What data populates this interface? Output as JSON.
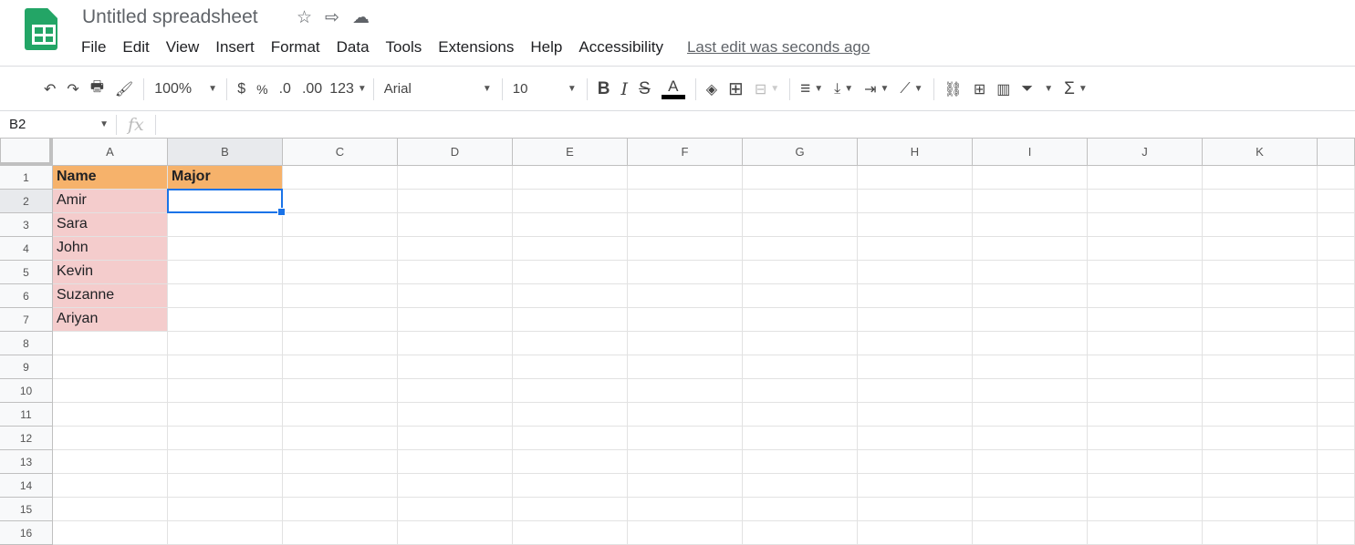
{
  "doc": {
    "title": "Untitled spreadsheet",
    "icons": [
      "star-icon",
      "move-to-folder-icon",
      "cloud-saved-icon"
    ]
  },
  "menu": [
    "File",
    "Edit",
    "View",
    "Insert",
    "Format",
    "Data",
    "Tools",
    "Extensions",
    "Help",
    "Accessibility"
  ],
  "last_edit": "Last edit was seconds ago",
  "toolbar": {
    "zoom": "100%",
    "currency": "$",
    "percent": "%",
    "dec_less": ".0",
    "dec_more": ".00",
    "more_formats": "123",
    "font": "Arial",
    "font_size": "10",
    "bold": "B",
    "italic": "I",
    "strike": "S",
    "text_color": "A",
    "text_color_value": "#000000"
  },
  "formula_bar": {
    "name_box": "B2",
    "fx": "fx",
    "value": ""
  },
  "grid": {
    "columns": [
      "A",
      "B",
      "C",
      "D",
      "E",
      "F",
      "G",
      "H",
      "I",
      "J",
      "K"
    ],
    "rows": [
      "1",
      "2",
      "3",
      "4",
      "5",
      "6",
      "7",
      "8",
      "9",
      "10",
      "11",
      "12",
      "13",
      "14",
      "15",
      "16"
    ],
    "selected_cell": "B2",
    "header_fill": "#f6b26b",
    "name_fill": "#f4cccc",
    "selection_color": "#1a73e8",
    "cells": [
      [
        "Name",
        "Major"
      ],
      [
        "Amir",
        ""
      ],
      [
        "Sara",
        ""
      ],
      [
        "John",
        ""
      ],
      [
        "Kevin",
        ""
      ],
      [
        "Suzanne",
        ""
      ],
      [
        "Ariyan",
        ""
      ]
    ]
  }
}
